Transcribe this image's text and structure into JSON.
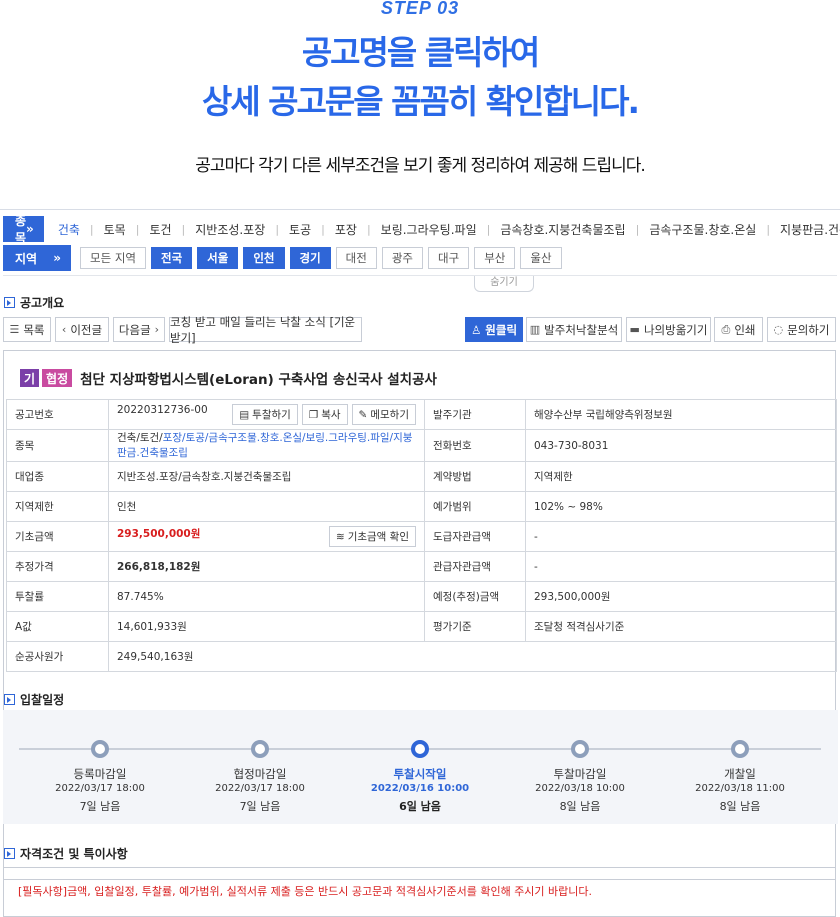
{
  "hero": {
    "step": "STEP 03",
    "line1": "공고명을 클릭하여",
    "line2": "상세 공고문을 꼼꼼히 확인합니다.",
    "sub": "공고마다 각기 다른 세부조건을 보기 좋게 정리하여 제공해 드립니다."
  },
  "filters": {
    "type_label": "종목",
    "region_label": "지역",
    "categories": [
      "건축",
      "토목",
      "토건",
      "지반조성.포장",
      "토공",
      "포장",
      "보링.그라우팅.파일",
      "금속창호.지붕건축물조립",
      "금속구조물.창호.온실",
      "지붕판금.건축물조"
    ],
    "active_category": "건축",
    "regions": [
      "모든 지역",
      "전국",
      "서울",
      "인천",
      "경기",
      "대전",
      "광주",
      "대구",
      "부산",
      "울산"
    ],
    "active_regions": [
      "전국",
      "서울",
      "인천",
      "경기"
    ],
    "hide_label": "숨기기"
  },
  "overview": {
    "section_title": "공고개요",
    "btn_list": "목록",
    "btn_prev": "이전글",
    "btn_next": "다음글",
    "banner": "코칭 받고 매일 들리는 낙찰 소식 [기운받기]",
    "btn_oneclick": "원클릭",
    "btn_analysis": "발주처낙찰분석",
    "btn_save": "나의방옮기기",
    "btn_print": "인쇄",
    "btn_inquiry": "문의하기"
  },
  "notice": {
    "badge1": "기",
    "badge2": "협정",
    "title": "첨단 지상파항법시스템(eLoran) 구축사업 송신국사 설치공사",
    "rows": {
      "no_label": "공고번호",
      "no_value": "20220312736-00",
      "btn_bid": "투찰하기",
      "btn_copy": "복사",
      "btn_memo": "메모하기",
      "agency_label": "발주기관",
      "agency_value": "해양수산부 국립해양측위정보원",
      "type_label": "종목",
      "type_value_plain": "건축/토건/",
      "type_value_link": "포장/토공/금속구조물.창호.온실/보링.그라우팅.파일/지붕판금.건축물조립",
      "phone_label": "전화번호",
      "phone_value": "043-730-8031",
      "major_label": "대업종",
      "major_value": "지반조성.포장/금속창호.지붕건축물조립",
      "contract_label": "계약방법",
      "contract_value": "지역제한",
      "regionlimit_label": "지역제한",
      "regionlimit_value": "인천",
      "range_label": "예가범위",
      "range_value": "102% ~ 98%",
      "base_label": "기초금액",
      "base_value": "293,500,000원",
      "btn_base": "기초금액 확인",
      "supply_label": "도급자관급액",
      "supply_value": "-",
      "est_label": "추정가격",
      "est_value": "266,818,182원",
      "gov_label": "관급자관급액",
      "gov_value": "-",
      "rate_label": "투찰률",
      "rate_value": "87.745%",
      "planned_label": "예정(추정)금액",
      "planned_value": "293,500,000원",
      "a_label": "A값",
      "a_value": "14,601,933원",
      "eval_label": "평가기준",
      "eval_value": "조달청 적격심사기준",
      "net_label": "순공사원가",
      "net_value": "249,540,163원"
    }
  },
  "schedule": {
    "section_title": "입찰일정",
    "steps": [
      {
        "name": "등록마감일",
        "date": "2022/03/17 18:00",
        "left": "7일 남음"
      },
      {
        "name": "협정마감일",
        "date": "2022/03/17 18:00",
        "left": "7일 남음"
      },
      {
        "name": "투찰시작일",
        "date": "2022/03/16 10:00",
        "left": "6일 남음"
      },
      {
        "name": "투찰마감일",
        "date": "2022/03/18 10:00",
        "left": "8일 남음"
      },
      {
        "name": "개찰일",
        "date": "2022/03/18 11:00",
        "left": "8일 남음"
      }
    ]
  },
  "qualification": {
    "section_title": "자격조건 및 특이사항",
    "notice": "[필독사항]금액, 입찰일정, 투찰률, 예가범위, 실적서류 제출 등은 반드시 공고문과 적격심사기준서를 확인해 주시기 바랍니다."
  }
}
